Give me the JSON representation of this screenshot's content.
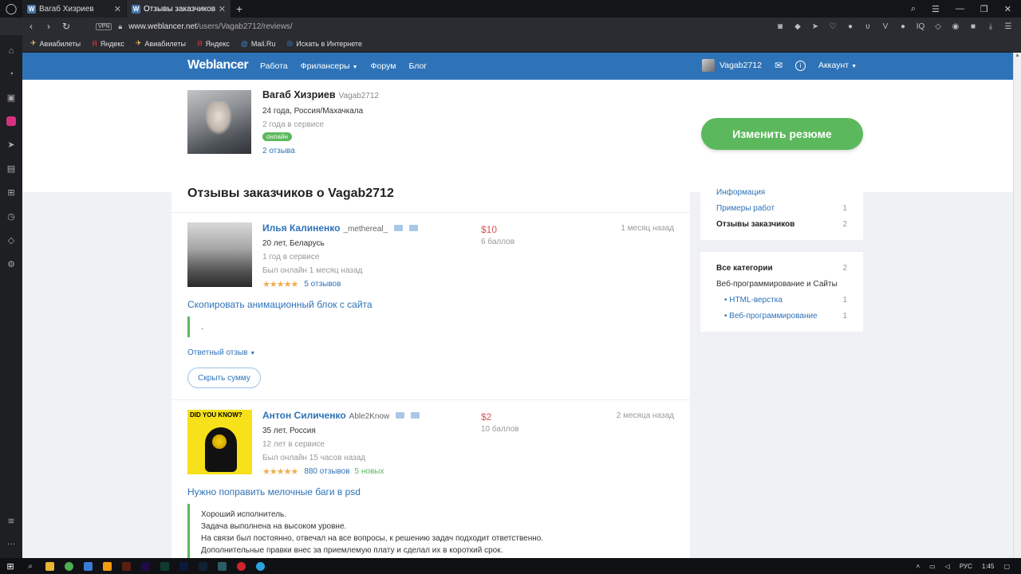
{
  "browser": {
    "tabs": [
      {
        "label": "Вагаб Хизриев",
        "favicon": "W"
      },
      {
        "label": "Отзывы заказчиков о Vag",
        "favicon": "W"
      }
    ],
    "vpn": "VPN",
    "url_host": "www.weblancer.net",
    "url_path": "/users/Vagab2712/reviews/",
    "bookmarks": [
      "Авиабилеты",
      "Яндекс",
      "Авиабилеты",
      "Яндекс",
      "Mail.Ru",
      "Искать в Интернете"
    ]
  },
  "site": {
    "logo": "Weblancer",
    "menu": [
      "Работа",
      "Фрилансеры",
      "Форум",
      "Блог"
    ],
    "user": "Vagab2712",
    "account": "Аккаунт"
  },
  "profile": {
    "name": "Вагаб Хизриев",
    "login": "Vagab2712",
    "age_location": "24 года, Россия/Махачкала",
    "service": "2 года в сервисе",
    "online": "онлайн",
    "reviews_link": "2 отзыва",
    "edit_button": "Изменить резюме"
  },
  "reviews_title": "Отзывы заказчиков о Vagab2712",
  "reviews": [
    {
      "name": "Илья Калиненко",
      "login": "_methereal_",
      "age_location": "20 лет, Беларусь",
      "service": "1 год в сервисе",
      "last_online": "Был онлайн 1 месяц назад",
      "stars": "★★★★★",
      "reviews_count": "5 отзывов",
      "new_count": "",
      "price": "$10",
      "points": "6 баллов",
      "ago": "1 месяц назад",
      "task": "Скопировать анимационный блок с сайта",
      "text": ".",
      "reply_toggle": "Ответный отзыв",
      "hide_sum": "Скрыть сумму"
    },
    {
      "name": "Антон Силиченко",
      "login": "Able2Know",
      "age_location": "35 лет, Россия",
      "service": "12 лет в сервисе",
      "last_online": "Был онлайн 15 часов назад",
      "stars": "★★★★★",
      "reviews_count": "880 отзывов",
      "new_count": "5 новых",
      "price": "$2",
      "points": "10 баллов",
      "ago": "2 месяца назад",
      "task": "Нужно поправить мелочные баги в psd",
      "avatar_caption": "DID YOU KNOW?",
      "text_lines": [
        "Хороший исполнитель.",
        "Задача выполнена на высоком уровне.",
        "На связи был постоянно, отвечал на все вопросы, к решению задач подходит ответственно.",
        "Дополнительные правки внес за приемлемую плату и сделал их в короткий срок."
      ]
    }
  ],
  "sidebar_nav": [
    {
      "label": "Информация",
      "count": ""
    },
    {
      "label": "Примеры работ",
      "count": "1"
    },
    {
      "label": "Отзывы заказчиков",
      "count": "2"
    }
  ],
  "sidebar_categories": [
    {
      "label": "Все категории",
      "count": "2"
    },
    {
      "label": "Веб-программирование и Сайты",
      "count": ""
    },
    {
      "label": "HTML-верстка",
      "count": "1"
    },
    {
      "label": "Веб-программирование",
      "count": "1"
    }
  ],
  "taskbar": {
    "lang": "РУС",
    "time": "1:45"
  },
  "colors": {
    "header_blue": "#2e73b8",
    "green": "#5cb85c",
    "price_red": "#d9534f",
    "star_orange": "#f0ad4e"
  }
}
